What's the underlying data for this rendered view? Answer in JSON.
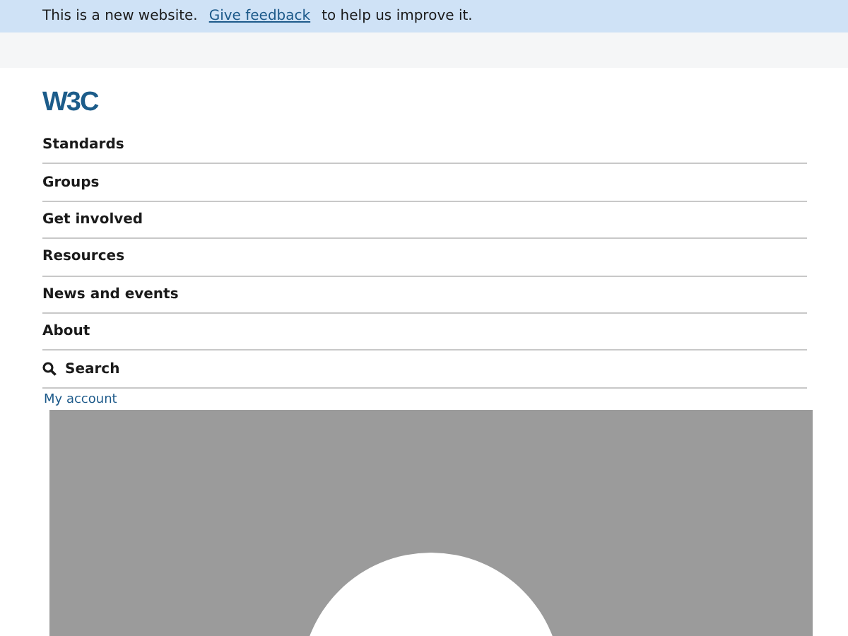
{
  "banner": {
    "text_before": "This is a new website.",
    "link": "Give feedback",
    "text_after": "to help us improve it."
  },
  "logo": {
    "text": "W3C"
  },
  "nav": [
    {
      "label": "Standards",
      "kind": "link"
    },
    {
      "label": "Groups",
      "kind": "link"
    },
    {
      "label": "Get involved",
      "kind": "link"
    },
    {
      "label": "Resources",
      "kind": "link"
    },
    {
      "label": "News and events",
      "kind": "link"
    },
    {
      "label": "About",
      "kind": "link"
    },
    {
      "label": "Search",
      "kind": "search"
    }
  ],
  "account_link": "My account"
}
